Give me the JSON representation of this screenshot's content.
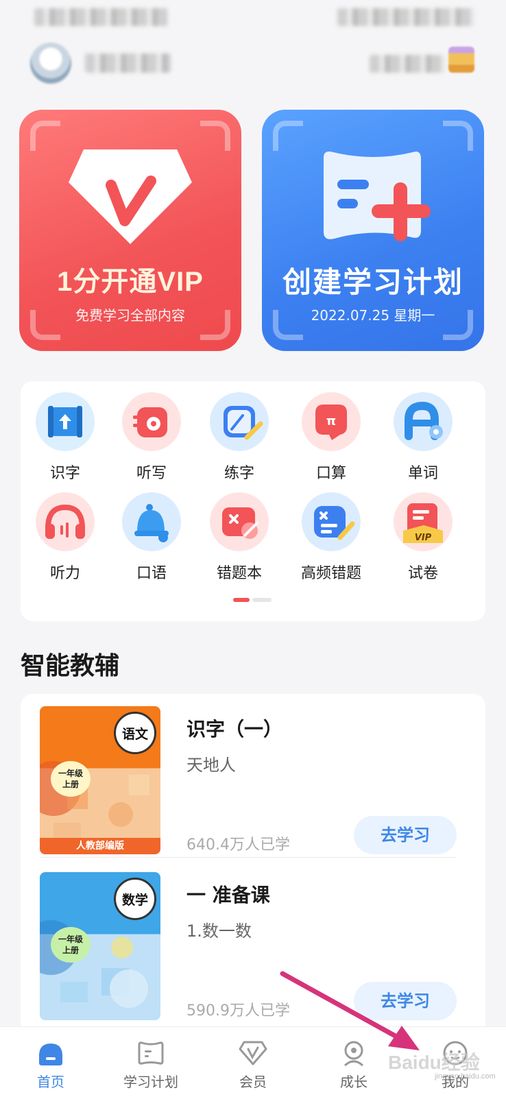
{
  "banners": {
    "vip": {
      "title": "1分开通VIP",
      "subtitle": "免费学习全部内容"
    },
    "plan": {
      "title": "创建学习计划",
      "subtitle": "2022.07.25 星期一"
    }
  },
  "tools": [
    {
      "label": "识字",
      "icon": "literacy-scroll-icon"
    },
    {
      "label": "听写",
      "icon": "dictation-icon"
    },
    {
      "label": "练字",
      "icon": "handwriting-icon"
    },
    {
      "label": "口算",
      "icon": "mental-math-icon"
    },
    {
      "label": "单词",
      "icon": "words-icon"
    },
    {
      "label": "听力",
      "icon": "headphones-icon"
    },
    {
      "label": "口语",
      "icon": "bell-icon"
    },
    {
      "label": "错题本",
      "icon": "mistake-book-icon"
    },
    {
      "label": "高频错题",
      "icon": "frequent-mistakes-icon"
    },
    {
      "label": "试卷",
      "icon": "vip-exam-paper-icon"
    }
  ],
  "section_title": "智能教辅",
  "courses": [
    {
      "cover": {
        "subject": "语文",
        "grade_line1": "一年级",
        "grade_line2": "上册",
        "edition": "人教部编版"
      },
      "title": "识字（一）",
      "subtitle": "天地人",
      "learners": "640.4万人已学",
      "button": "去学习"
    },
    {
      "cover": {
        "subject": "数学",
        "grade_line1": "一年级",
        "grade_line2": "上册",
        "edition": ""
      },
      "title": "一 准备课",
      "subtitle": "1.数一数",
      "learners": "590.9万人已学",
      "button": "去学习"
    }
  ],
  "tabbar": [
    {
      "label": "首页",
      "icon": "home-icon",
      "active": true
    },
    {
      "label": "学习计划",
      "icon": "study-plan-icon",
      "active": false
    },
    {
      "label": "会员",
      "icon": "vip-icon",
      "active": false
    },
    {
      "label": "成长",
      "icon": "growth-icon",
      "active": false
    },
    {
      "label": "我的",
      "icon": "profile-icon",
      "active": false
    }
  ],
  "colors": {
    "vip_red": "#f25457",
    "plan_blue": "#3c80f0",
    "active_blue": "#3f86e6",
    "annotation_arrow": "#d6337a"
  },
  "watermark": {
    "brand": "Baidu经验",
    "url": "jingyan.baidu.com"
  }
}
